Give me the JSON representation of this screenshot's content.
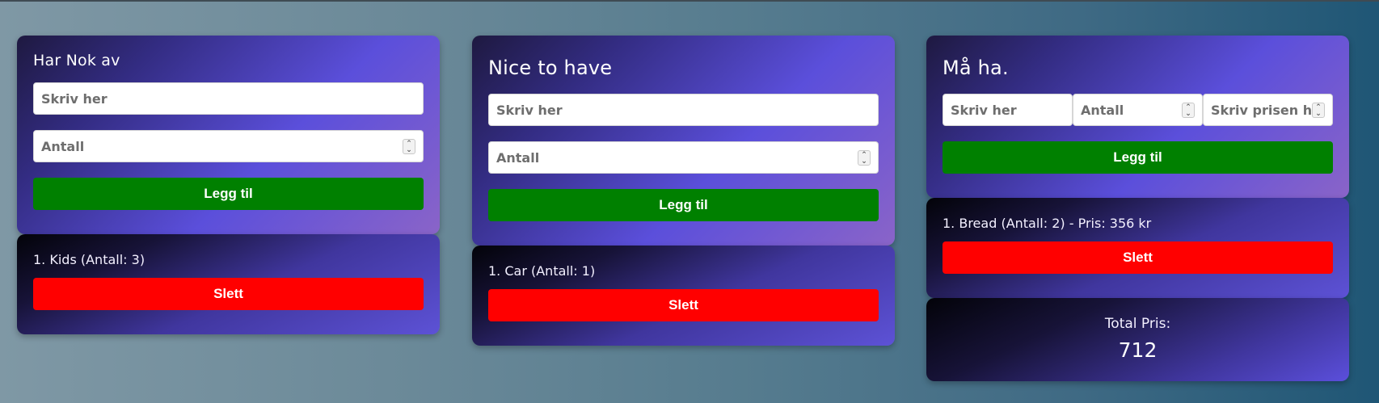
{
  "columns": [
    {
      "title": "Har Nok av",
      "inputs": {
        "name_placeholder": "Skriv her",
        "quantity_placeholder": "Antall"
      },
      "add_label": "Legg til",
      "items": [
        {
          "text": "1. Kids (Antall: 3)",
          "delete_label": "Slett"
        }
      ]
    },
    {
      "title": "Nice to have",
      "inputs": {
        "name_placeholder": "Skriv her",
        "quantity_placeholder": "Antall"
      },
      "add_label": "Legg til",
      "items": [
        {
          "text": "1. Car (Antall: 1)",
          "delete_label": "Slett"
        }
      ]
    },
    {
      "title": "Må ha.",
      "inputs": {
        "name_placeholder": "Skriv her",
        "quantity_placeholder": "Antall",
        "price_placeholder": "Skriv prisen her"
      },
      "add_label": "Legg til",
      "items": [
        {
          "text": "1. Bread (Antall: 2) - Pris: 356 kr",
          "delete_label": "Slett"
        }
      ],
      "total": {
        "label": "Total Pris:",
        "value": "712"
      }
    }
  ],
  "icons": {
    "stepper": "stepper-icon"
  },
  "colors": {
    "add_button": "#008000",
    "delete_button": "#ff0000"
  }
}
